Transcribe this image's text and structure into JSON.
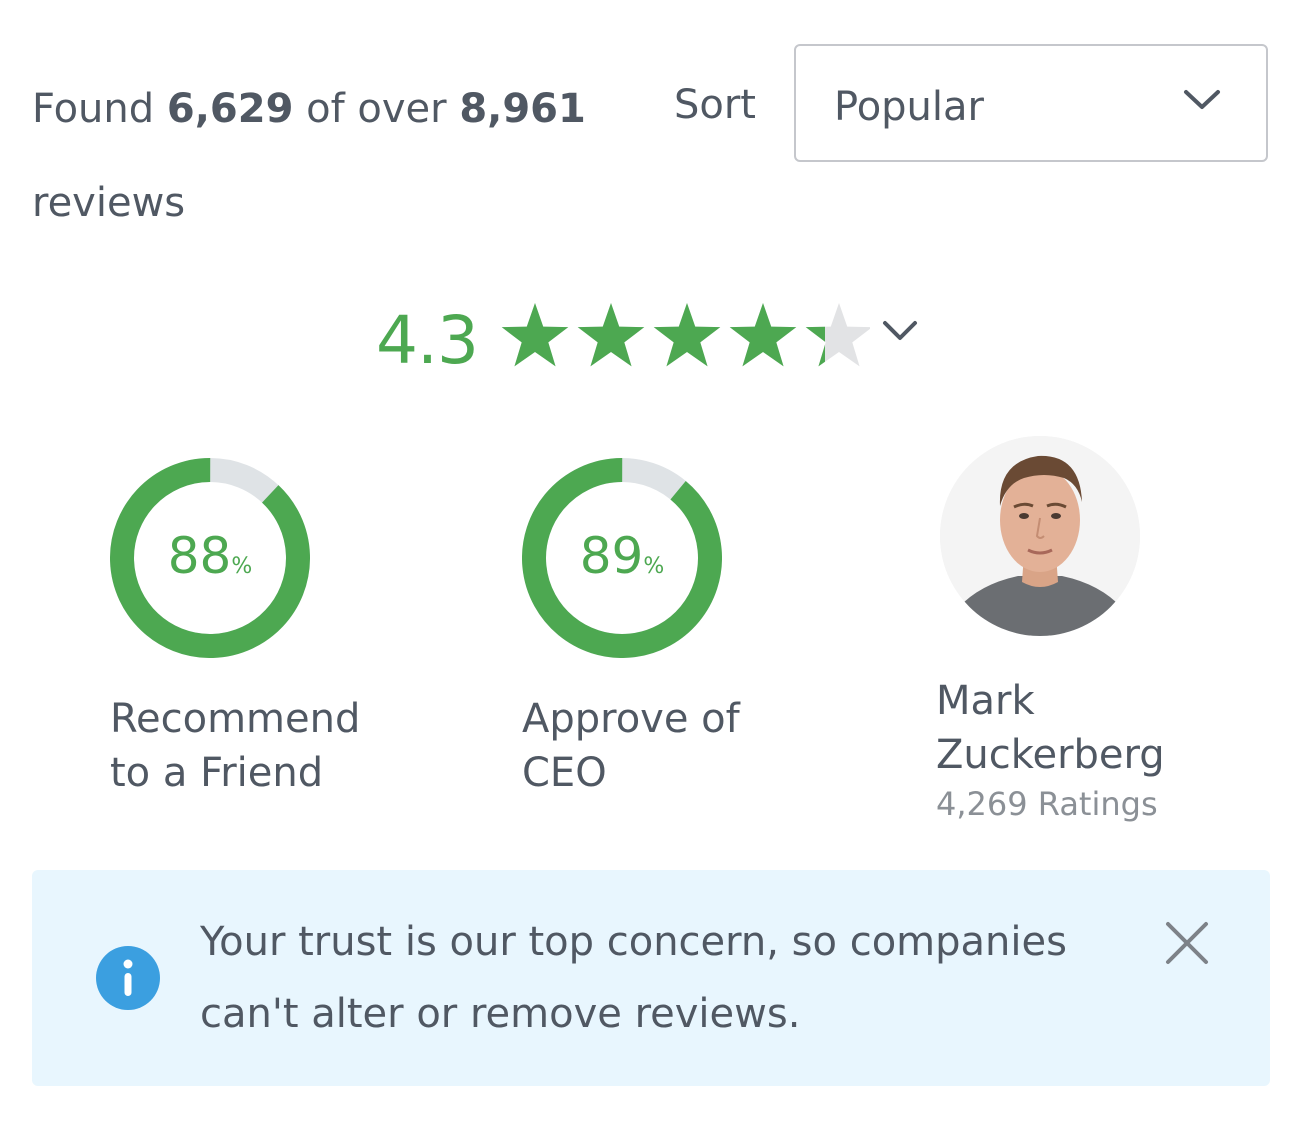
{
  "header": {
    "found_prefix": "Found",
    "found_count": "6,629",
    "found_mid": "of over",
    "total_count": "8,961",
    "found_suffix": "reviews",
    "sort_label": "Sort",
    "sort_value": "Popular",
    "sort_icon": "chevron-down-icon"
  },
  "rating": {
    "value": "4.3",
    "stars": 4.3,
    "max_stars": 5,
    "expand_icon": "chevron-down-icon"
  },
  "stats": [
    {
      "percent": 88,
      "percent_text": "88",
      "percent_sign": "%",
      "label_line1": "Recommend",
      "label_line2": "to a Friend"
    },
    {
      "percent": 89,
      "percent_text": "89",
      "percent_sign": "%",
      "label_line1": "Approve of",
      "label_line2": "CEO"
    }
  ],
  "ceo": {
    "name_line1": "Mark",
    "name_line2": "Zuckerberg",
    "ratings_text": "4,269 Ratings"
  },
  "notice": {
    "line1": "Your trust is our top concern, so companies",
    "line2": "can't alter or remove reviews.",
    "info_icon": "info-icon",
    "close_icon": "close-icon"
  },
  "colors": {
    "accent_green": "#4da851",
    "track_gray": "#dfe3e6",
    "star_empty": "#e2e3e5",
    "notice_bg": "#e8f6fe",
    "info_blue": "#3b9fe0",
    "text": "#505863"
  }
}
